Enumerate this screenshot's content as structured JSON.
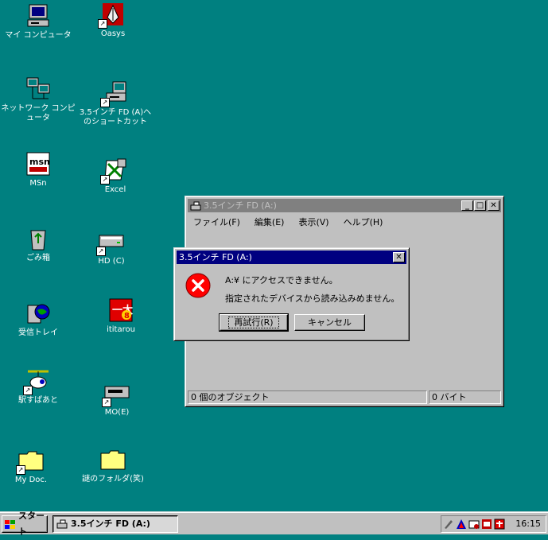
{
  "desktop": {
    "icons": [
      {
        "id": "my-computer",
        "label": "マイ コンピュータ"
      },
      {
        "id": "oasys",
        "label": "Oasys"
      },
      {
        "id": "network",
        "label": "ネットワーク コンピュータ"
      },
      {
        "id": "fd-shortcut",
        "label": "3.5インチ FD (A)へ\nのショートカット"
      },
      {
        "id": "msn",
        "label": "MSn"
      },
      {
        "id": "excel",
        "label": "Excel"
      },
      {
        "id": "recycle",
        "label": "ごみ箱"
      },
      {
        "id": "hd",
        "label": "HD (C)"
      },
      {
        "id": "inbox",
        "label": "受信トレイ"
      },
      {
        "id": "ititarou",
        "label": "ititarou"
      },
      {
        "id": "ekisupa",
        "label": "駅すぱあと"
      },
      {
        "id": "mo",
        "label": "MO(E)"
      },
      {
        "id": "mydoc",
        "label": "My Doc."
      },
      {
        "id": "nazo-folder",
        "label": "謎のフォルダ(笑)"
      }
    ],
    "background_color": "#008080"
  },
  "explorer": {
    "title": "3.5インチ FD (A:)",
    "menu": [
      "ファイル(F)",
      "編集(E)",
      "表示(V)",
      "ヘルプ(H)"
    ],
    "status_objects": "0 個のオブジェクト",
    "status_size": "0 バイト"
  },
  "dialog": {
    "title": "3.5インチ FD (A:)",
    "line1": "A:¥ にアクセスできません。",
    "line2": "指定されたデバイスから読み込みめません。",
    "retry_label": "再試行(R)",
    "cancel_label": "キャンセル",
    "close_glyph": "✕",
    "error_glyph": "✕"
  },
  "taskbar": {
    "start_label": "スタート",
    "task_label": "3.5インチ FD (A:)",
    "clock": "16:15"
  },
  "window_buttons": {
    "minimize": "_",
    "maximize": "□",
    "close": "✕"
  }
}
